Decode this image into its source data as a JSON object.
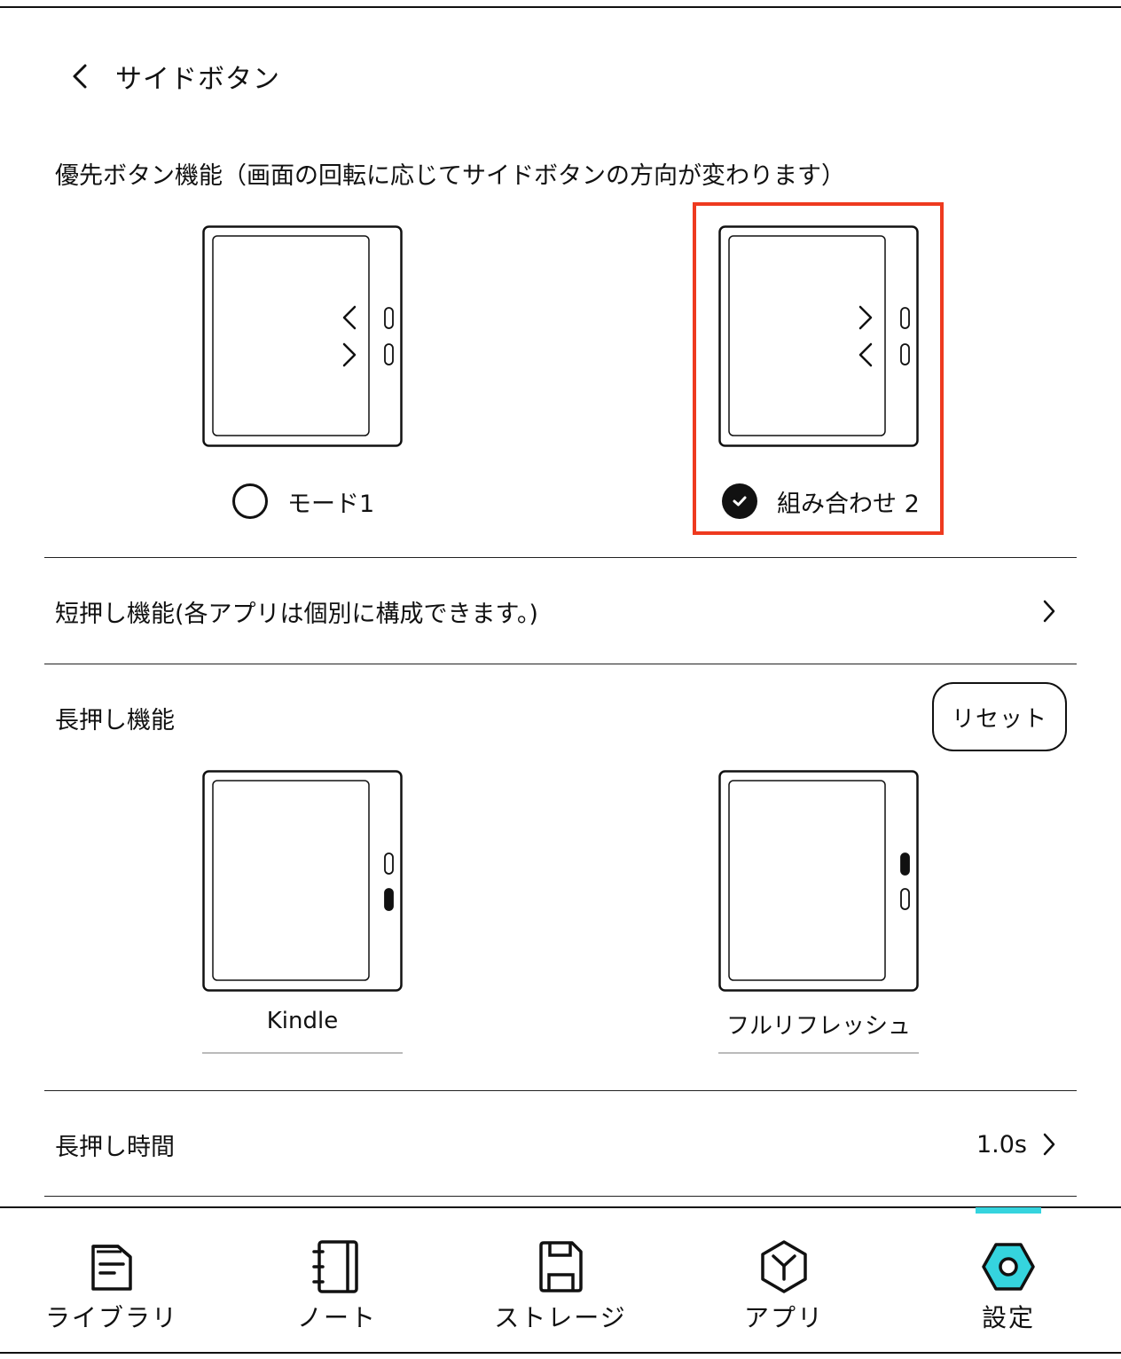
{
  "header": {
    "title": "サイドボタン"
  },
  "priority": {
    "label": "優先ボタン機能（画面の回転に応じてサイドボタンの方向が変わります）",
    "options": [
      {
        "label": "モード1",
        "selected": false
      },
      {
        "label": "組み合わせ 2",
        "selected": true
      }
    ]
  },
  "short_press": {
    "label": "短押し機能(各アプリは個別に構成できます。)"
  },
  "long_press": {
    "label": "長押し機能",
    "reset_label": "リセット",
    "assignments": [
      {
        "label": "Kindle"
      },
      {
        "label": "フルリフレッシュ"
      }
    ]
  },
  "long_press_time": {
    "label": "長押し時間",
    "value": "1.0s"
  },
  "bottom_nav": {
    "items": [
      {
        "label": "ライブラリ",
        "icon": "library-icon"
      },
      {
        "label": "ノート",
        "icon": "notebook-icon"
      },
      {
        "label": "ストレージ",
        "icon": "save-icon"
      },
      {
        "label": "アプリ",
        "icon": "apps-icon"
      },
      {
        "label": "設定",
        "icon": "settings-icon",
        "active": true
      }
    ],
    "active_color": "#35d4de"
  },
  "colors": {
    "highlight": "#ee3a1f"
  }
}
